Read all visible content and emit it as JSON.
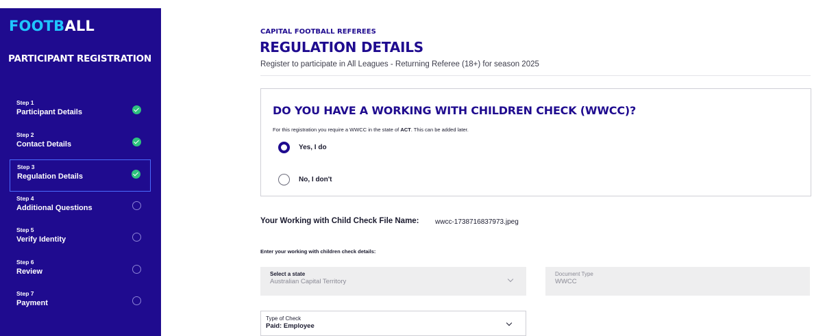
{
  "brand": {
    "logo_accent": "FOOTB",
    "logo_rest": "ALL",
    "accent_color": "#1fc6ff",
    "sidebar_color": "#1f0b8f"
  },
  "sidebar": {
    "title": "PARTICIPANT REGISTRATION",
    "steps": [
      {
        "num": "Step 1",
        "label": "Participant Details",
        "status": "check-circle-icon"
      },
      {
        "num": "Step 2",
        "label": "Contact Details",
        "status": "check-circle-icon"
      },
      {
        "num": "Step 3",
        "label": "Regulation Details",
        "status": "check-circle-icon"
      },
      {
        "num": "Step 4",
        "label": "Additional Questions",
        "status": "empty-circle-icon"
      },
      {
        "num": "Step 5",
        "label": "Verify Identity",
        "status": "empty-circle-icon"
      },
      {
        "num": "Step 6",
        "label": "Review",
        "status": "empty-circle-icon"
      },
      {
        "num": "Step 7",
        "label": "Payment",
        "status": "empty-circle-icon"
      }
    ]
  },
  "header": {
    "org": "CAPITAL FOOTBALL REFEREES",
    "title": "REGULATION DETAILS",
    "subtitle": "Register to participate in All Leagues - Returning Referee (18+) for season 2025"
  },
  "wwcc": {
    "question": "DO YOU HAVE A WORKING WITH CHILDREN CHECK (WWCC)?",
    "note_prefix": "For this registration you require a WWCC in the state of ",
    "note_state": "ACT",
    "note_suffix": ". This can be added later.",
    "options": [
      {
        "label": "Yes, I do",
        "selected": true
      },
      {
        "label": "No, I don't",
        "selected": false
      }
    ]
  },
  "file": {
    "label": "Your Working with Child Check File Name:",
    "name": "wwcc-1738716837973.jpeg"
  },
  "details": {
    "intro": "Enter your working with children check details:",
    "state": {
      "caption": "Select a state",
      "value": "Australian Capital Territory"
    },
    "doc_type": {
      "caption": "Document Type",
      "value": "WWCC"
    },
    "check_type": {
      "caption": "Type of Check",
      "value": "Paid: Employee"
    }
  }
}
